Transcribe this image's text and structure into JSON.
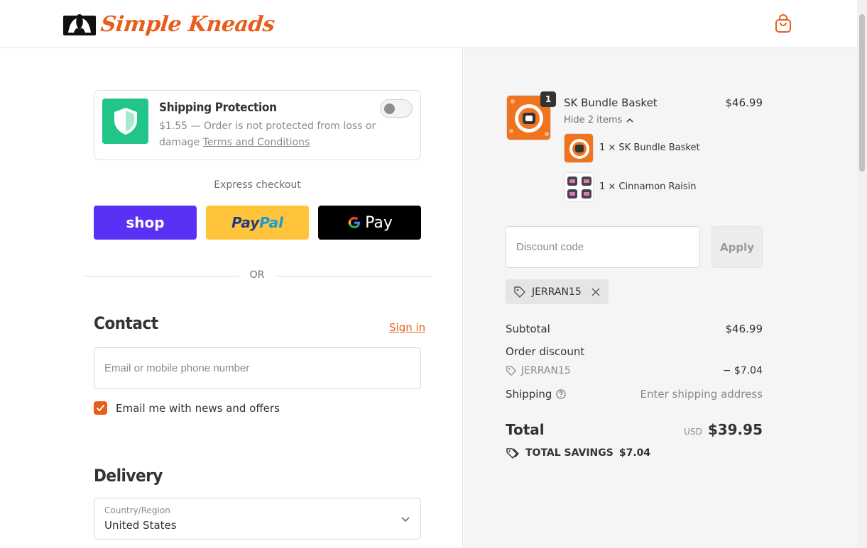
{
  "brand": {
    "name": "Simple Kneads",
    "accent": "#e85d1a"
  },
  "header": {
    "cart_icon": "shopping-bag-icon"
  },
  "protection": {
    "title": "Shipping Protection",
    "desc": "$1.55 — Order is not protected from loss or damage",
    "terms": "Terms and Conditions",
    "enabled": false
  },
  "express": {
    "label": "Express checkout",
    "shop": "shop",
    "paypal_a": "Pay",
    "paypal_b": "Pal",
    "gpay": "Pay",
    "or": "OR"
  },
  "contact": {
    "title": "Contact",
    "signin": "Sign in",
    "email_placeholder": "Email or mobile phone number",
    "news_label": "Email me with news and offers",
    "news_checked": true
  },
  "delivery": {
    "title": "Delivery",
    "country_label": "Country/Region",
    "country_value": "United States"
  },
  "summary": {
    "product": {
      "name": "SK Bundle Basket",
      "price": "$46.99",
      "qty": "1"
    },
    "hide_items": "Hide 2 items",
    "sub_items": [
      "1 × SK Bundle Basket",
      "1 × Cinnamon Raisin"
    ],
    "discount_placeholder": "Discount code",
    "apply": "Apply",
    "code": "JERRAN15",
    "subtotal_label": "Subtotal",
    "subtotal": "$46.99",
    "order_discount_label": "Order discount",
    "discount_code": "JERRAN15",
    "discount_amount": "− $7.04",
    "shipping_label": "Shipping",
    "shipping_value": "Enter shipping address",
    "total_label": "Total",
    "currency": "USD",
    "total": "$39.95",
    "savings_label": "TOTAL SAVINGS",
    "savings": "$7.04"
  }
}
